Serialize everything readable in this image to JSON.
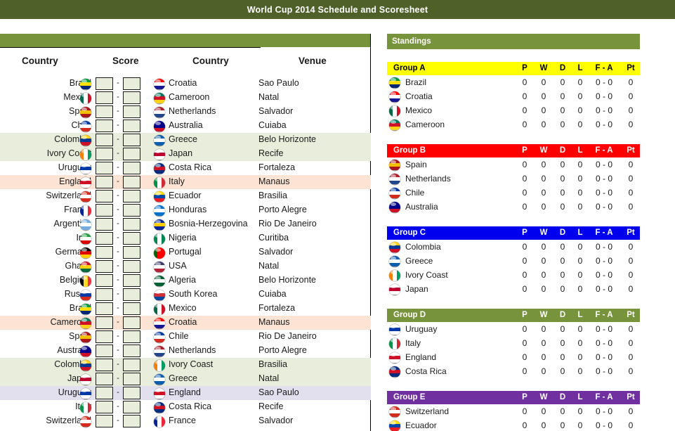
{
  "title": "World Cup 2014 Schedule and Scoresheet",
  "schedule": {
    "headers": {
      "country1": "Country",
      "score": "Score",
      "country2": "Country",
      "venue": "Venue"
    },
    "score_separator": "-",
    "score_home": "",
    "score_away": "",
    "matches": [
      {
        "home": "Brazil",
        "away": "Croatia",
        "venue": "Sao Paulo",
        "highlight": "none"
      },
      {
        "home": "Mexico",
        "away": "Cameroon",
        "venue": "Natal",
        "highlight": "none"
      },
      {
        "home": "Spain",
        "away": "Netherlands",
        "venue": "Salvador",
        "highlight": "none"
      },
      {
        "home": "Chile",
        "away": "Australia",
        "venue": "Cuiaba",
        "highlight": "none"
      },
      {
        "home": "Colombia",
        "away": "Greece",
        "venue": "Belo Horizonte",
        "highlight": "green"
      },
      {
        "home": "Ivory Coast",
        "away": "Japan",
        "venue": "Recife",
        "highlight": "green"
      },
      {
        "home": "Uruguay",
        "away": "Costa Rica",
        "venue": "Fortaleza",
        "highlight": "none"
      },
      {
        "home": "England",
        "away": "Italy",
        "venue": "Manaus",
        "highlight": "peach"
      },
      {
        "home": "Switzerland",
        "away": "Ecuador",
        "venue": "Brasilia",
        "highlight": "none"
      },
      {
        "home": "France",
        "away": "Honduras",
        "venue": "Porto Alegre",
        "highlight": "none"
      },
      {
        "home": "Argentina",
        "away": "Bosnia-Herzegovina",
        "venue": "Rio De Janeiro",
        "highlight": "none"
      },
      {
        "home": "Iran",
        "away": "Nigeria",
        "venue": "Curitiba",
        "highlight": "none"
      },
      {
        "home": "Germany",
        "away": "Portugal",
        "venue": "Salvador",
        "highlight": "none"
      },
      {
        "home": "Ghana",
        "away": "USA",
        "venue": "Natal",
        "highlight": "none"
      },
      {
        "home": "Belgium",
        "away": "Algeria",
        "venue": "Belo Horizonte",
        "highlight": "none"
      },
      {
        "home": "Russia",
        "away": "South Korea",
        "venue": "Cuiaba",
        "highlight": "none"
      },
      {
        "home": "Brazil",
        "away": "Mexico",
        "venue": "Fortaleza",
        "highlight": "none"
      },
      {
        "home": "Cameroon",
        "away": "Croatia",
        "venue": "Manaus",
        "highlight": "peach"
      },
      {
        "home": "Spain",
        "away": "Chile",
        "venue": "Rio De Janeiro",
        "highlight": "none"
      },
      {
        "home": "Australia",
        "away": "Netherlands",
        "venue": "Porto Alegre",
        "highlight": "none"
      },
      {
        "home": "Colombia",
        "away": "Ivory Coast",
        "venue": "Brasilia",
        "highlight": "green"
      },
      {
        "home": "Japan",
        "away": "Greece",
        "venue": "Natal",
        "highlight": "green"
      },
      {
        "home": "Uruguay",
        "away": "England",
        "venue": "Sao Paulo",
        "highlight": "lav"
      },
      {
        "home": "Italy",
        "away": "Costa Rica",
        "venue": "Recife",
        "highlight": "none"
      },
      {
        "home": "Switzerland",
        "away": "France",
        "venue": "Salvador",
        "highlight": "none"
      }
    ]
  },
  "standings": {
    "label": "Standings",
    "columns": [
      "P",
      "W",
      "D",
      "L",
      "F - A",
      "Pt"
    ],
    "groups": [
      {
        "name": "Group A",
        "header_bg": "#ffff00",
        "header_fg": "#000000",
        "teams": [
          {
            "name": "Brazil",
            "p": "0",
            "w": "0",
            "d": "0",
            "l": "0",
            "fa": "0 - 0",
            "pt": "0"
          },
          {
            "name": "Croatia",
            "p": "0",
            "w": "0",
            "d": "0",
            "l": "0",
            "fa": "0 - 0",
            "pt": "0"
          },
          {
            "name": "Mexico",
            "p": "0",
            "w": "0",
            "d": "0",
            "l": "0",
            "fa": "0 - 0",
            "pt": "0"
          },
          {
            "name": "Cameroon",
            "p": "0",
            "w": "0",
            "d": "0",
            "l": "0",
            "fa": "0 - 0",
            "pt": "0"
          }
        ]
      },
      {
        "name": "Group B",
        "header_bg": "#ff0000",
        "header_fg": "#ffffff",
        "teams": [
          {
            "name": "Spain",
            "p": "0",
            "w": "0",
            "d": "0",
            "l": "0",
            "fa": "0 - 0",
            "pt": "0"
          },
          {
            "name": "Netherlands",
            "p": "0",
            "w": "0",
            "d": "0",
            "l": "0",
            "fa": "0 - 0",
            "pt": "0"
          },
          {
            "name": "Chile",
            "p": "0",
            "w": "0",
            "d": "0",
            "l": "0",
            "fa": "0 - 0",
            "pt": "0"
          },
          {
            "name": "Australia",
            "p": "0",
            "w": "0",
            "d": "0",
            "l": "0",
            "fa": "0 - 0",
            "pt": "0"
          }
        ]
      },
      {
        "name": "Group C",
        "header_bg": "#0000ee",
        "header_fg": "#ffffff",
        "teams": [
          {
            "name": "Colombia",
            "p": "0",
            "w": "0",
            "d": "0",
            "l": "0",
            "fa": "0 - 0",
            "pt": "0"
          },
          {
            "name": "Greece",
            "p": "0",
            "w": "0",
            "d": "0",
            "l": "0",
            "fa": "0 - 0",
            "pt": "0"
          },
          {
            "name": "Ivory Coast",
            "p": "0",
            "w": "0",
            "d": "0",
            "l": "0",
            "fa": "0 - 0",
            "pt": "0"
          },
          {
            "name": "Japan",
            "p": "0",
            "w": "0",
            "d": "0",
            "l": "0",
            "fa": "0 - 0",
            "pt": "0"
          }
        ]
      },
      {
        "name": "Group D",
        "header_bg": "#77933c",
        "header_fg": "#ffffff",
        "teams": [
          {
            "name": "Uruguay",
            "p": "0",
            "w": "0",
            "d": "0",
            "l": "0",
            "fa": "0 - 0",
            "pt": "0"
          },
          {
            "name": "Italy",
            "p": "0",
            "w": "0",
            "d": "0",
            "l": "0",
            "fa": "0 - 0",
            "pt": "0"
          },
          {
            "name": "England",
            "p": "0",
            "w": "0",
            "d": "0",
            "l": "0",
            "fa": "0 - 0",
            "pt": "0"
          },
          {
            "name": "Costa Rica",
            "p": "0",
            "w": "0",
            "d": "0",
            "l": "0",
            "fa": "0 - 0",
            "pt": "0"
          }
        ]
      },
      {
        "name": "Group E",
        "header_bg": "#7030a0",
        "header_fg": "#ffffff",
        "teams": [
          {
            "name": "Switzerland",
            "p": "0",
            "w": "0",
            "d": "0",
            "l": "0",
            "fa": "0 - 0",
            "pt": "0"
          },
          {
            "name": "Ecuador",
            "p": "0",
            "w": "0",
            "d": "0",
            "l": "0",
            "fa": "0 - 0",
            "pt": "0"
          }
        ]
      }
    ]
  },
  "flags": {
    "Brazil": [
      "#009b3a",
      "#ffdf00",
      "#002776"
    ],
    "Croatia": [
      "#ff0000",
      "#ffffff",
      "#171796"
    ],
    "Mexico": [
      "#006847",
      "#ffffff",
      "#ce1126"
    ],
    "Cameroon": [
      "#007a5e",
      "#ce1126",
      "#fcd116"
    ],
    "Spain": [
      "#aa151b",
      "#f1bf00",
      "#aa151b"
    ],
    "Netherlands": [
      "#ae1c28",
      "#ffffff",
      "#21468b"
    ],
    "Chile": [
      "#0039a6",
      "#ffffff",
      "#d52b1e"
    ],
    "Australia": [
      "#00008b",
      "#00008b",
      "#ce1126"
    ],
    "Colombia": [
      "#fcd116",
      "#003893",
      "#ce1126"
    ],
    "Greece": [
      "#0d5eaf",
      "#ffffff",
      "#0d5eaf"
    ],
    "Ivory Coast": [
      "#f77f00",
      "#ffffff",
      "#009e60"
    ],
    "Japan": [
      "#ffffff",
      "#bc002d",
      "#ffffff"
    ],
    "Uruguay": [
      "#ffffff",
      "#0038a8",
      "#ffffff"
    ],
    "Costa Rica": [
      "#002b7f",
      "#ce1126",
      "#002b7f"
    ],
    "England": [
      "#ffffff",
      "#ce1124",
      "#ffffff"
    ],
    "Italy": [
      "#009246",
      "#ffffff",
      "#ce2b37"
    ],
    "Switzerland": [
      "#d52b1e",
      "#ffffff",
      "#d52b1e"
    ],
    "Ecuador": [
      "#ffdd00",
      "#0047ab",
      "#ed1c24"
    ],
    "France": [
      "#002395",
      "#ffffff",
      "#ed2939"
    ],
    "Honduras": [
      "#0073cf",
      "#ffffff",
      "#0073cf"
    ],
    "Argentina": [
      "#74acdf",
      "#ffffff",
      "#74acdf"
    ],
    "Bosnia-Herzegovina": [
      "#002395",
      "#fecb00",
      "#002395"
    ],
    "Iran": [
      "#239f40",
      "#ffffff",
      "#da0000"
    ],
    "Nigeria": [
      "#008751",
      "#ffffff",
      "#008751"
    ],
    "Germany": [
      "#000000",
      "#dd0000",
      "#ffce00"
    ],
    "Portugal": [
      "#006600",
      "#ff0000",
      "#ff0000"
    ],
    "Ghana": [
      "#ce1126",
      "#fcd116",
      "#006b3f"
    ],
    "USA": [
      "#3c3b6e",
      "#ffffff",
      "#b22234"
    ],
    "Belgium": [
      "#000000",
      "#fdda24",
      "#ef3340"
    ],
    "Algeria": [
      "#006233",
      "#ffffff",
      "#006233"
    ],
    "Russia": [
      "#ffffff",
      "#0039a6",
      "#d52b1e"
    ],
    "South Korea": [
      "#ffffff",
      "#cd2e3a",
      "#0047a0"
    ]
  }
}
